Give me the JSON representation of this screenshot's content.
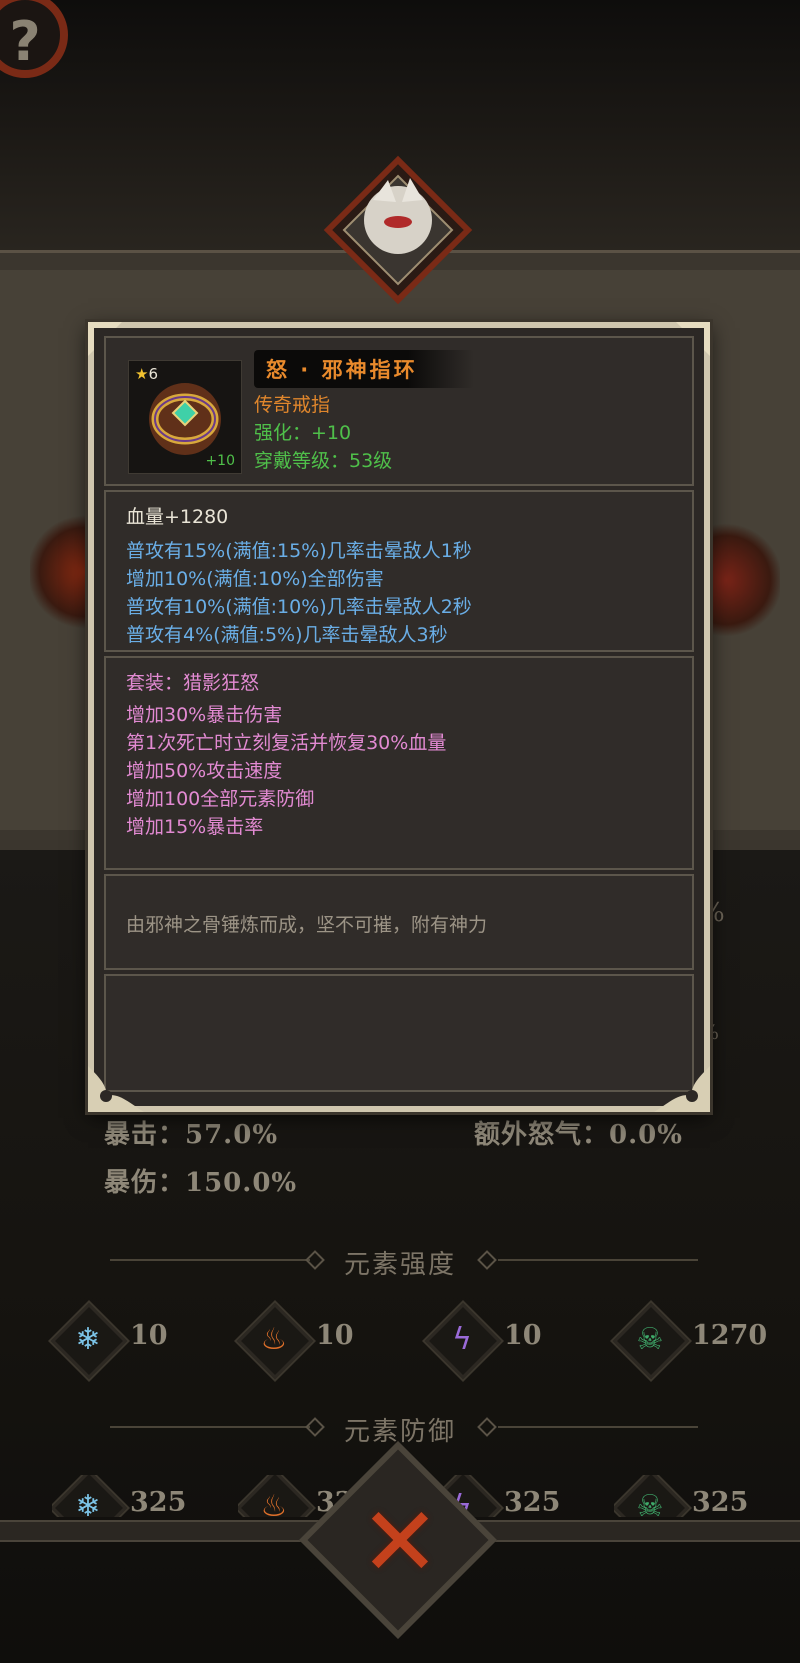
{
  "item": {
    "star_level": "6",
    "enhance_badge": "+10",
    "name": "怒 · 邪神指环",
    "type": "传奇戒指",
    "enhance": "强化：+10",
    "wear_level": "穿戴等级：53级"
  },
  "base_stat": "血量+1280",
  "random_attrs": [
    "普攻有15%(满值:15%)几率击晕敌人1秒",
    "增加10%(满值:10%)全部伤害",
    "普攻有10%(满值:10%)几率击晕敌人2秒",
    "普攻有4%(满值:5%)几率击晕敌人3秒"
  ],
  "set": {
    "title": "套装：猎影狂怒",
    "effects": [
      "增加30%暴击伤害",
      "第1次死亡时立刻复活并恢复30%血量",
      "增加50%攻击速度",
      "增加100全部元素防御",
      "增加15%暴击率"
    ]
  },
  "description": "由邪神之骨锤炼而成，坚不可摧，附有神力",
  "stats": {
    "crit": "暴击：57.0%",
    "crit_damage": "暴伤：150.0%",
    "extra_rage": "额外怒气：0.0%",
    "hidden_pct_1": "%",
    "hidden_pct_2": "%"
  },
  "element_strength": {
    "title": "元素强度",
    "values": [
      "10",
      "10",
      "10",
      "1270"
    ]
  },
  "element_defense": {
    "title": "元素防御",
    "values": [
      "325",
      "325",
      "325",
      "325"
    ]
  },
  "icons": {
    "help": "question-mark-icon",
    "ice": "snowflake-icon",
    "fire": "flame-icon",
    "lightning": "lightning-icon",
    "poison": "skull-icon",
    "close": "close-icon"
  },
  "colors": {
    "name": "#e98a2c",
    "legendary": "#e0862c",
    "green": "#4fc04a",
    "blue_attr": "#6aaee6",
    "set_pink": "#e28ad2",
    "description": "#9c9486"
  }
}
